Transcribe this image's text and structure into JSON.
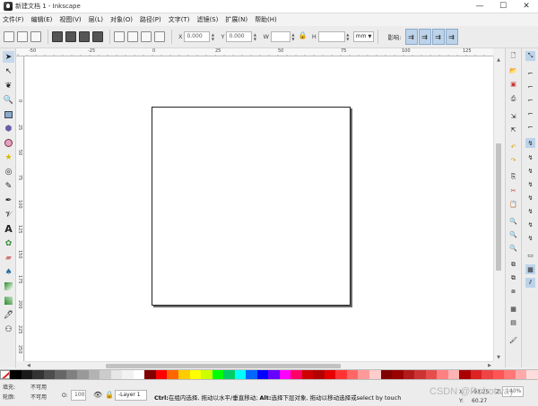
{
  "window": {
    "title": "新建文档 1 - Inkscape",
    "controls": [
      "—",
      "☐",
      "✕"
    ]
  },
  "menubar": {
    "items": [
      "文件(F)",
      "编辑(E)",
      "视图(V)",
      "层(L)",
      "对象(O)",
      "路径(P)",
      "文字(T)",
      "滤镜(S)",
      "扩展(N)",
      "帮助(H)"
    ]
  },
  "command_bar": {
    "x_label": "X",
    "x_value": "0.000",
    "y_label": "Y",
    "y_value": "0.000",
    "w_label": "W",
    "w_value": "",
    "h_label": "H",
    "h_value": "",
    "unit": "mm",
    "affect_label": "影响:"
  },
  "rulers": {
    "top_ticks": [
      "-50",
      "-25",
      "0",
      "25",
      "50",
      "75",
      "100",
      "125"
    ],
    "left_ticks": [
      "0",
      "25",
      "50",
      "75",
      "100",
      "125",
      "150",
      "175",
      "200",
      "225",
      "250",
      "275"
    ]
  },
  "status": {
    "fill_label": "填充:",
    "fill_value": "不可用",
    "stroke_label": "轮廓:",
    "stroke_value": "不可用",
    "opacity_label": "O:",
    "opacity_value": "100",
    "layer_name": "-Layer 1",
    "message_ctrl": "Ctrl:",
    "message_ctrl_text": "在组内选择, 拖动以水平/垂直移动;",
    "message_alt": "Alt:",
    "message_alt_text": "选择下层对象, 拖动以移动选择或select by touch",
    "x_coord_label": "X:",
    "x_coord": "-93.25",
    "y_coord_label": "Y:",
    "y_coord": "60.27",
    "zoom_label": "Z:",
    "zoom_value": "140%"
  },
  "watermark": "CSDN @Robotway",
  "palette_colors": [
    "#000000",
    "#1a1a1a",
    "#333333",
    "#4d4d4d",
    "#666666",
    "#808080",
    "#999999",
    "#b3b3b3",
    "#cccccc",
    "#e6e6e6",
    "#f2f2f2",
    "#ffffff",
    "#800000",
    "#ff0000",
    "#ff6600",
    "#ffcc00",
    "#ffff00",
    "#ccff00",
    "#00ff00",
    "#00cc66",
    "#00ffff",
    "#0066ff",
    "#0000ff",
    "#6600ff",
    "#ff00ff",
    "#ff0066",
    "#cc0000",
    "#b30000",
    "#e60000",
    "#ff3333",
    "#ff6666",
    "#ff9999",
    "#ffcccc",
    "#800000",
    "#990000",
    "#b31a1a",
    "#cc3333",
    "#e64d4d",
    "#ff8080",
    "#ffb3b3",
    "#aa0000",
    "#dd2222",
    "#ee4444",
    "#ff5555",
    "#ff7777",
    "#ffaaaa",
    "#ffdddd"
  ],
  "icons": {
    "tools": [
      "selector-icon",
      "node-icon",
      "tweak-icon",
      "zoom-icon",
      "rect-icon",
      "3dbox-icon",
      "circle-icon",
      "star-icon",
      "spiral-icon",
      "pencil-icon",
      "pen-icon",
      "calligraphy-icon",
      "text-icon",
      "spray-icon",
      "eraser-icon",
      "bucket-icon",
      "gradient-icon",
      "mesh-icon",
      "dropper-icon",
      "connector-icon"
    ]
  }
}
